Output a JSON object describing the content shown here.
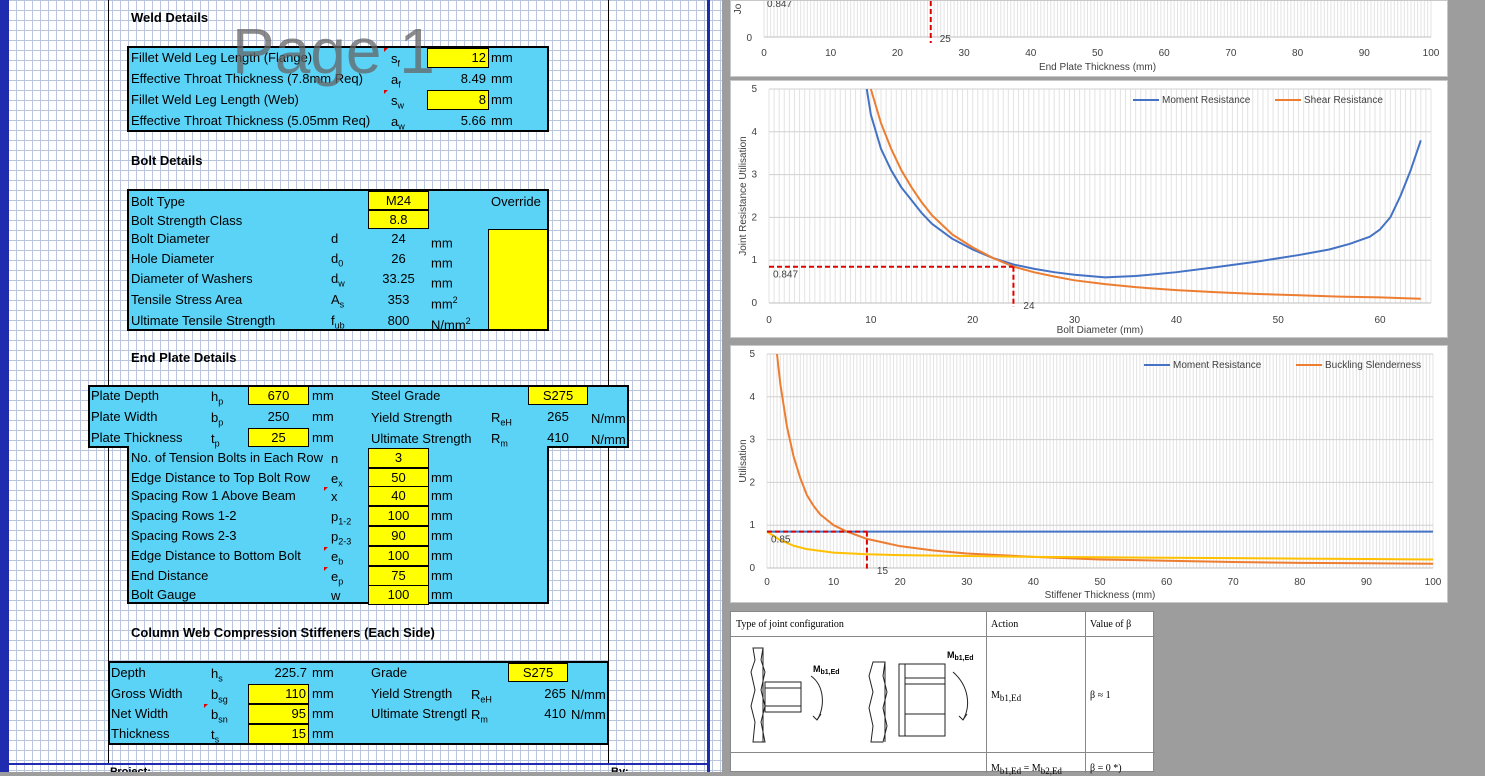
{
  "watermark": "Page 1",
  "weld": {
    "title": "Weld Details",
    "rows": [
      {
        "label": "Fillet Weld Leg Length (Flange)",
        "sym": "s",
        "sub": "f",
        "value": "12",
        "unit": "mm"
      },
      {
        "label": "Effective Throat Thickness (7.8mm Req)",
        "sym": "a",
        "sub": "f",
        "value": "8.49",
        "unit": "mm"
      },
      {
        "label": "Fillet Weld Leg Length (Web)",
        "sym": "s",
        "sub": "w",
        "value": "8",
        "unit": "mm"
      },
      {
        "label": "Effective Throat Thickness (5.05mm Req)",
        "sym": "a",
        "sub": "w",
        "value": "5.66",
        "unit": "mm"
      }
    ]
  },
  "bolt": {
    "title": "Bolt Details",
    "type_label": "Bolt Type",
    "type_value": "M24",
    "override_label": "Override",
    "class_label": "Bolt Strength Class",
    "class_value": "8.8",
    "rows": [
      {
        "label": "Bolt Diameter",
        "sym": "d",
        "sub": "",
        "value": "24",
        "unit": "mm",
        "sup": ""
      },
      {
        "label": "Hole Diameter",
        "sym": "d",
        "sub": "0",
        "value": "26",
        "unit": "mm",
        "sup": ""
      },
      {
        "label": "Diameter of Washers",
        "sym": "d",
        "sub": "w",
        "value": "33.25",
        "unit": "mm",
        "sup": ""
      },
      {
        "label": "Tensile Stress Area",
        "sym": "A",
        "sub": "s",
        "value": "353",
        "unit": "mm",
        "sup": "2"
      },
      {
        "label": "Ultimate Tensile Strength",
        "sym": "f",
        "sub": "ub",
        "value": "800",
        "unit": "N/mm",
        "sup": "2"
      }
    ]
  },
  "endplate": {
    "title": "End Plate Details",
    "depth_label": "Plate Depth",
    "depth_sym": "h",
    "depth_sub": "p",
    "depth_value": "670",
    "depth_unit": "mm",
    "width_label": "Plate Width",
    "width_sym": "b",
    "width_sub": "p",
    "width_value": "250",
    "width_unit": "mm",
    "thk_label": "Plate Thickness",
    "thk_sym": "t",
    "thk_sub": "p",
    "thk_value": "25",
    "thk_unit": "mm",
    "grade_label": "Steel Grade",
    "grade_value": "S275",
    "ys_label": "Yield Strength",
    "ys_sym": "R",
    "ys_sub": "eH",
    "ys_value": "265",
    "ys_unit": "N/mm",
    "us_label": "Ultimate Strength",
    "us_sym": "R",
    "us_sub": "m",
    "us_value": "410",
    "us_unit": "N/mm",
    "rows": [
      {
        "label": "No. of Tension Bolts in Each Row",
        "sym": "n",
        "sub": "",
        "value": "3",
        "unit": ""
      },
      {
        "label": "Edge Distance to Top Bolt Row",
        "sym": "e",
        "sub": "x",
        "value": "50",
        "unit": "mm"
      },
      {
        "label": "Spacing Row 1 Above Beam",
        "sym": "x",
        "sub": "",
        "value": "40",
        "unit": "mm"
      },
      {
        "label": "Spacing Rows 1-2",
        "sym": "p",
        "sub": "1-2",
        "value": "100",
        "unit": "mm"
      },
      {
        "label": "Spacing Rows 2-3",
        "sym": "p",
        "sub": "2-3",
        "value": "90",
        "unit": "mm"
      },
      {
        "label": "Edge Distance to Bottom Bolt",
        "sym": "e",
        "sub": "b",
        "value": "100",
        "unit": "mm"
      },
      {
        "label": "End Distance",
        "sym": "e",
        "sub": "p",
        "value": "75",
        "unit": "mm"
      },
      {
        "label": "Bolt Gauge",
        "sym": "w",
        "sub": "",
        "value": "100",
        "unit": "mm"
      }
    ]
  },
  "stiff": {
    "title": "Column Web Compression Stiffeners (Each Side)",
    "depth_label": "Depth",
    "depth_sym": "h",
    "depth_sub": "s",
    "depth_value": "225.7",
    "depth_unit": "mm",
    "gw_label": "Gross Width",
    "gw_sym": "b",
    "gw_sub": "sg",
    "gw_value": "110",
    "gw_unit": "mm",
    "nw_label": "Net Width",
    "nw_sym": "b",
    "nw_sub": "sn",
    "nw_value": "95",
    "nw_unit": "mm",
    "thk_label": "Thickness",
    "thk_sym": "t",
    "thk_sub": "s",
    "thk_value": "15",
    "thk_unit": "mm",
    "grade_label": "Grade",
    "grade_value": "S275",
    "ys_label": "Yield Strength",
    "ys_sym": "R",
    "ys_sub": "eH",
    "ys_value": "265",
    "ys_unit": "N/mm",
    "us_label": "Ultimate Strengtl",
    "us_sym": "R",
    "us_sub": "m",
    "us_value": "410",
    "us_unit": "N/mm"
  },
  "footer": {
    "project": "Project:",
    "by": "By:"
  },
  "colors": {
    "cell_blue": "#5bd3f6",
    "input_yellow": "#ffff00",
    "moment": "#4472c4",
    "shear": "#ed7d31",
    "third": "#ffc000",
    "marker": "#e00000"
  },
  "chart_data": [
    {
      "type": "line",
      "xlabel": "End Plate Thickness (mm)",
      "ylabel": "Jo",
      "x_ticks": [
        0,
        10,
        20,
        30,
        40,
        50,
        60,
        70,
        80,
        90,
        100
      ],
      "xlim": [
        0,
        100
      ],
      "y_ticks": [
        0
      ],
      "marker": {
        "x": 25,
        "y": 0.847,
        "x_label": "25",
        "y_label": "0.847"
      }
    },
    {
      "type": "line",
      "xlabel": "Bolt Diameter (mm)",
      "ylabel": "Joint Resistance Utilisation",
      "xlim": [
        0,
        65
      ],
      "ylim": [
        0,
        5
      ],
      "x_ticks": [
        0,
        10,
        20,
        30,
        40,
        50,
        60
      ],
      "y_ticks": [
        0,
        1,
        2,
        3,
        4,
        5
      ],
      "series": [
        {
          "name": "Moment Resistance",
          "color": "#4472c4",
          "x": [
            9.6,
            10,
            11,
            12,
            13,
            14,
            15,
            16,
            18,
            20,
            22,
            24,
            26,
            28,
            30,
            33,
            36,
            40,
            44,
            48,
            52,
            55,
            57,
            59,
            60,
            61,
            62,
            63,
            64
          ],
          "y": [
            5,
            4.4,
            3.6,
            3.1,
            2.7,
            2.4,
            2.1,
            1.85,
            1.5,
            1.25,
            1.05,
            0.9,
            0.8,
            0.72,
            0.66,
            0.6,
            0.63,
            0.72,
            0.84,
            0.97,
            1.12,
            1.25,
            1.38,
            1.55,
            1.72,
            2.0,
            2.5,
            3.1,
            3.8
          ]
        },
        {
          "name": "Shear Resistance",
          "color": "#ed7d31",
          "x": [
            10,
            11,
            12,
            13,
            14,
            15,
            16,
            18,
            20,
            22,
            24,
            26,
            28,
            30,
            33,
            36,
            40,
            44,
            48,
            52,
            56,
            60,
            64
          ],
          "y": [
            5,
            4.2,
            3.6,
            3.1,
            2.7,
            2.35,
            2.05,
            1.6,
            1.3,
            1.05,
            0.85,
            0.72,
            0.62,
            0.53,
            0.44,
            0.37,
            0.3,
            0.25,
            0.21,
            0.18,
            0.15,
            0.13,
            0.1
          ]
        }
      ],
      "marker": {
        "x": 24,
        "y": 0.847,
        "x_label": "24",
        "y_label": "0.847"
      }
    },
    {
      "type": "line",
      "xlabel": "Stiffener Thickness (mm)",
      "ylabel": "Utilisation",
      "xlim": [
        0,
        100
      ],
      "ylim": [
        0,
        5
      ],
      "x_ticks": [
        0,
        10,
        20,
        30,
        40,
        50,
        60,
        70,
        80,
        90,
        100
      ],
      "y_ticks": [
        0,
        1,
        2,
        3,
        4,
        5
      ],
      "series": [
        {
          "name": "Moment Resistance",
          "color": "#4472c4",
          "x": [
            0,
            100
          ],
          "y": [
            0.85,
            0.85
          ]
        },
        {
          "name": "Buckling Slenderness",
          "color": "#ed7d31",
          "x": [
            1.5,
            2,
            3,
            4,
            5,
            6,
            7,
            8,
            10,
            12,
            15,
            20,
            25,
            30,
            40,
            50,
            60,
            70,
            80,
            90,
            100
          ],
          "y": [
            5,
            4.3,
            3.3,
            2.6,
            2.1,
            1.7,
            1.45,
            1.25,
            1.0,
            0.85,
            0.68,
            0.51,
            0.41,
            0.34,
            0.26,
            0.2,
            0.17,
            0.14,
            0.12,
            0.11,
            0.1
          ]
        },
        {
          "color": "#ffc000",
          "x": [
            0,
            2,
            4,
            6,
            8,
            10,
            15,
            20,
            30,
            40,
            50,
            60,
            70,
            80,
            90,
            100
          ],
          "y": [
            0.85,
            0.65,
            0.52,
            0.44,
            0.4,
            0.36,
            0.32,
            0.3,
            0.28,
            0.26,
            0.25,
            0.24,
            0.23,
            0.22,
            0.21,
            0.2
          ]
        }
      ],
      "marker": {
        "x": 15,
        "y": 0.85,
        "x_label": "15",
        "y_label": "0.85"
      }
    }
  ],
  "beta_table": {
    "h1": "Type of joint configuration",
    "h2": "Action",
    "h3": "Value of β",
    "m1": "M",
    "m1_sub": "b1,Ed",
    "m2": "M",
    "m2_sub": "b1,Ed",
    "action": "M",
    "action_sub": "b1,Ed",
    "value": "β ≈ 1",
    "action2": "M",
    "action2_sub": "b1,Ed",
    "action2_tail": " = M",
    "action2_sub2": "b2,Ed",
    "value2": "β = 0    *)"
  }
}
